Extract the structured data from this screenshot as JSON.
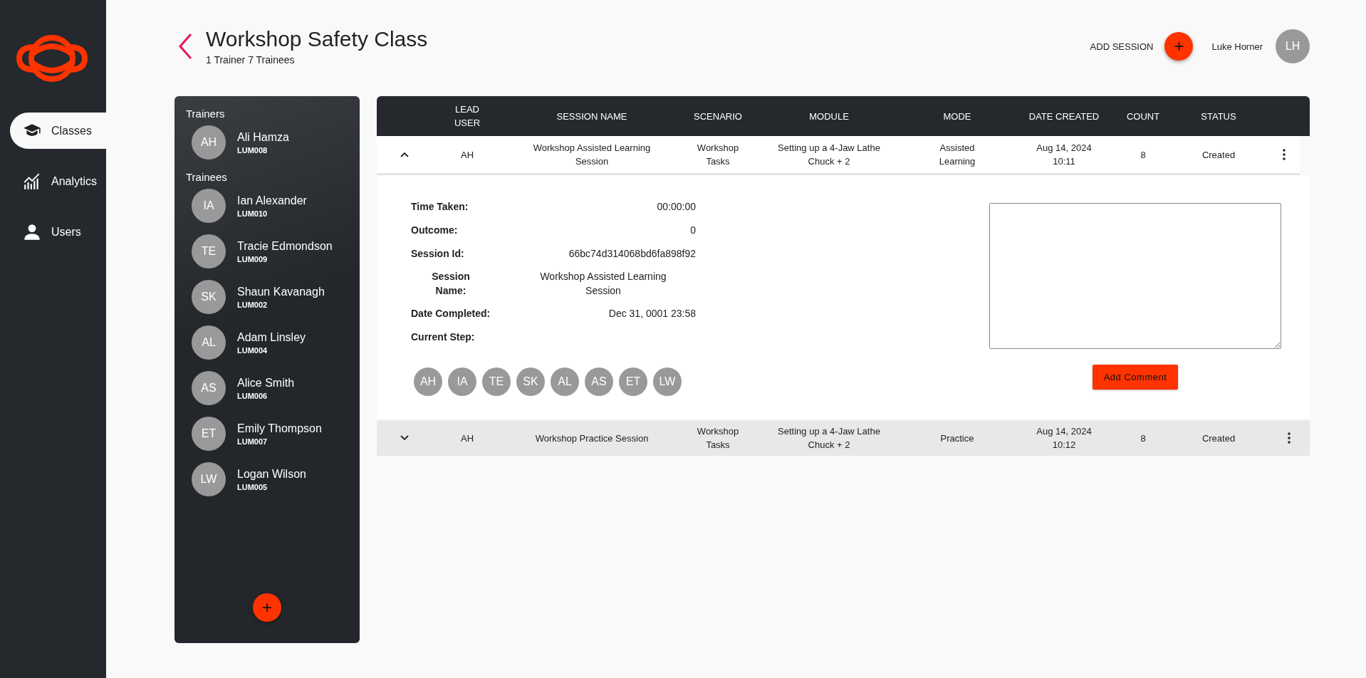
{
  "nav": {
    "items": [
      {
        "label": "Classes",
        "kind": "cap",
        "selected": true
      },
      {
        "label": "Analytics",
        "kind": "chart",
        "selected": false
      },
      {
        "label": "Users",
        "kind": "person",
        "selected": false
      }
    ]
  },
  "header": {
    "title": "Workshop Safety Class",
    "subtitle": "1 Trainer 7 Trainees",
    "add_label": "ADD SESSION",
    "add_button": "+",
    "user_name": "Luke Horner",
    "user_initials": "LH"
  },
  "roster": {
    "sections": [
      {
        "heading": "Trainers",
        "members": [
          {
            "initials": "AH",
            "name": "Ali Hamza",
            "code": "LUM008"
          }
        ]
      },
      {
        "heading": "Trainees",
        "members": [
          {
            "initials": "IA",
            "name": "Ian Alexander",
            "code": "LUM010"
          },
          {
            "initials": "TE",
            "name": "Tracie Edmondson",
            "code": "LUM009"
          },
          {
            "initials": "SK",
            "name": "Shaun Kavanagh",
            "code": "LUM002"
          },
          {
            "initials": "AL",
            "name": "Adam Linsley",
            "code": "LUM004"
          },
          {
            "initials": "AS",
            "name": "Alice Smith",
            "code": "LUM006"
          },
          {
            "initials": "ET",
            "name": "Emily Thompson",
            "code": "LUM007"
          },
          {
            "initials": "LW",
            "name": "Logan Wilson",
            "code": "LUM005"
          }
        ]
      }
    ],
    "add_button": "+"
  },
  "table": {
    "columns": [
      "LEAD USER",
      "SESSION NAME",
      "SCENARIO",
      "MODULE",
      "MODE",
      "DATE CREATED",
      "COUNT",
      "STATUS"
    ],
    "rows": [
      {
        "expanded": true,
        "cells": [
          "AH",
          "Workshop Assisted Learning Session",
          "Workshop Tasks",
          "Setting up a 4-Jaw Lathe Chuck + 2",
          "Assisted Learning",
          "Aug 14, 2024 10:11",
          "8",
          "Created"
        ],
        "details": {
          "fields": [
            {
              "kind": "plain",
              "label": "Time Taken:",
              "value": "00:00:00"
            },
            {
              "kind": "plain",
              "label": "Outcome:",
              "value": "0"
            },
            {
              "kind": "plain",
              "label": "Session Id:",
              "value": "66bc74d314068bd6fa898f92"
            },
            {
              "kind": "centered",
              "label": "Session Name:",
              "value": "Workshop Assisted Learning Session"
            },
            {
              "kind": "plain",
              "label": "Date Completed:",
              "value": "Dec 31, 0001 23:58"
            },
            {
              "kind": "plain",
              "label": "Current Step:"
            }
          ],
          "participants": [
            "AH",
            "IA",
            "TE",
            "SK",
            "AL",
            "AS",
            "ET",
            "LW"
          ],
          "comment_button": "Add Comment"
        }
      },
      {
        "expanded": false,
        "cells": [
          "AH",
          "Workshop Practice Session",
          "Workshop Tasks",
          "Setting up a 4-Jaw Lathe Chuck + 2",
          "Practice",
          "Aug 14, 2024 10:12",
          "8",
          "Created"
        ]
      }
    ]
  }
}
